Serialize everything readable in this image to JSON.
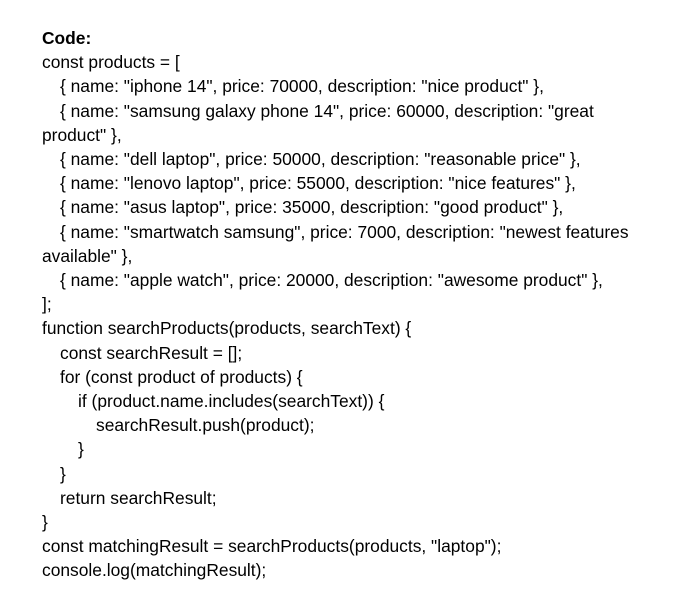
{
  "heading": "Code:",
  "lines": [
    "const products = [",
    "{ name: \"iphone 14\", price: 70000, description: \"nice product\" },",
    "{ name: \"samsung galaxy phone 14\", price: 60000, description: \"great",
    "product\" },",
    "{ name: \"dell laptop\", price: 50000, description: \"reasonable price\" },",
    "{ name: \"lenovo laptop\", price: 55000, description: \"nice features\" },",
    "{ name: \"asus laptop\", price: 35000, description: \"good product\" },",
    "{ name: \"smartwatch samsung\", price: 7000, description: \"newest features",
    "available\" },",
    "{ name: \"apple watch\", price: 20000, description: \"awesome product\" },",
    "];",
    "function searchProducts(products, searchText) {",
    "const searchResult = [];",
    "for (const product of products) {",
    "if (product.name.includes(searchText)) {",
    "searchResult.push(product);",
    "}",
    "}",
    "return searchResult;",
    "}",
    "const matchingResult = searchProducts(products, \"laptop\");",
    "console.log(matchingResult);"
  ]
}
